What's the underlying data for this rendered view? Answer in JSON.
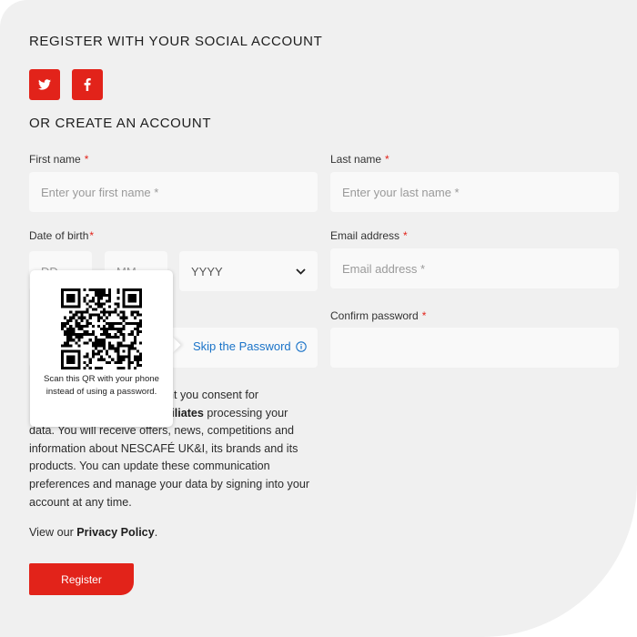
{
  "social": {
    "heading": "REGISTER WITH YOUR SOCIAL ACCOUNT",
    "twitter_icon": "twitter-icon",
    "facebook_icon": "facebook-icon"
  },
  "create": {
    "heading": "OR CREATE AN ACCOUNT"
  },
  "form": {
    "first_name": {
      "label": "First name",
      "required": "*",
      "placeholder": "Enter your first name *"
    },
    "last_name": {
      "label": "Last name",
      "required": "*",
      "placeholder": "Enter your last name *"
    },
    "dob": {
      "label": "Date of birth",
      "required": "*",
      "day_placeholder": "DD",
      "month_placeholder": "MM",
      "year_value": "YYYY"
    },
    "email": {
      "label": "Email address",
      "required": "*",
      "placeholder": "Email address *"
    },
    "confirm_password": {
      "label": "Confirm password",
      "required": "*",
      "value": ""
    },
    "skip_password": {
      "label": "Skip the Password",
      "icon": "info-icon"
    }
  },
  "qr_popover": {
    "text": "Scan this QR with your phone instead of using a password.",
    "icon": "qr-code"
  },
  "consent": {
    "line1_visible": "nt you consent for",
    "line2_bold": "filiates",
    "line2_rest": " processing your",
    "rest": "data. You will receive offers, news, competitions and information about NESCAFÉ UK&I, its brands and its products. You can update these communication preferences and manage your data by signing into your account at any time."
  },
  "privacy": {
    "prefix": "View our ",
    "link": "Privacy Policy",
    "suffix": "."
  },
  "register_button": "Register",
  "colors": {
    "accent": "#e2231a",
    "link": "#1a73c8",
    "background": "#f0f0f0",
    "field": "#f9f9f9"
  }
}
